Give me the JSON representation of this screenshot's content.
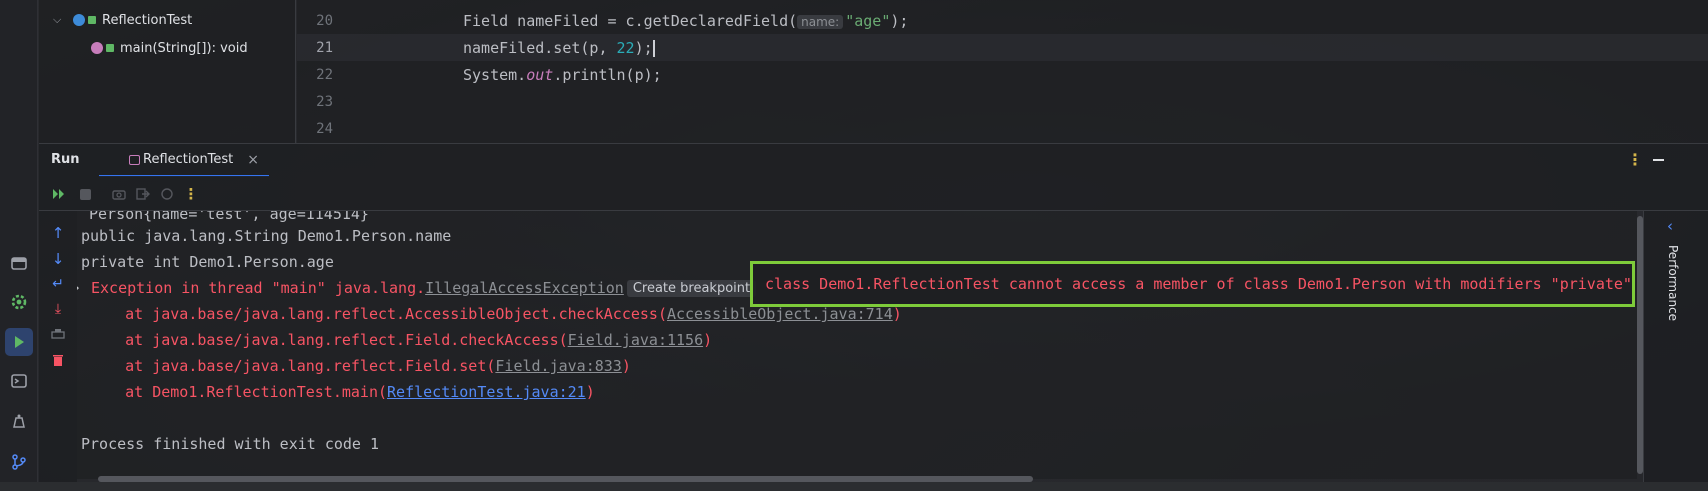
{
  "structure": {
    "class_name": "ReflectionTest",
    "method_name": "main(String[]): void"
  },
  "editor": {
    "lines": [
      {
        "num": "20",
        "pre": "Field nameFiled = c.getDeclaredField(",
        "hint": "name:",
        "str": "\"age\"",
        "post": ");"
      },
      {
        "num": "21",
        "pre": "nameFiled.set(p, ",
        "number": "22",
        "post": ");"
      },
      {
        "num": "22",
        "pre": "System.",
        "field": "out",
        "post": ".println(p);"
      },
      {
        "num": "23"
      },
      {
        "num": "24"
      }
    ]
  },
  "run": {
    "title": "Run",
    "tab_label": "ReflectionTest"
  },
  "console": {
    "line0": "Person{name='test', age=114514}",
    "line1": "public java.lang.String Demo1.Person.name",
    "line2": "private int Demo1.Person.age",
    "exception_prefix": "Exception in thread \"main\" java.lang.",
    "exception_link": "IllegalAccessException",
    "breakpoint_chip": "Create breakpoint",
    "exception_message": "class Demo1.ReflectionTest cannot access a member of class Demo1.Person with modifiers \"private\"",
    "trace": [
      {
        "prefix": "    at java.base/java.lang.reflect.AccessibleObject.checkAccess(",
        "link": "AccessibleObject.java:714",
        "suffix": ")"
      },
      {
        "prefix": "    at java.base/java.lang.reflect.Field.checkAccess(",
        "link": "Field.java:1156",
        "suffix": ")"
      },
      {
        "prefix": "    at java.base/java.lang.reflect.Field.set(",
        "link": "Field.java:833",
        "suffix": ")"
      },
      {
        "prefix": "    at Demo1.ReflectionTest.main(",
        "link": "ReflectionTest.java:21",
        "suffix": ")"
      }
    ],
    "exit_line": "Process finished with exit code 1"
  },
  "right_panel": {
    "label": "Performance"
  },
  "colors": {
    "accent": "#3574f0",
    "error": "#f75464",
    "highlight_border": "#7ecb3a",
    "link_blue": "#548af7"
  }
}
